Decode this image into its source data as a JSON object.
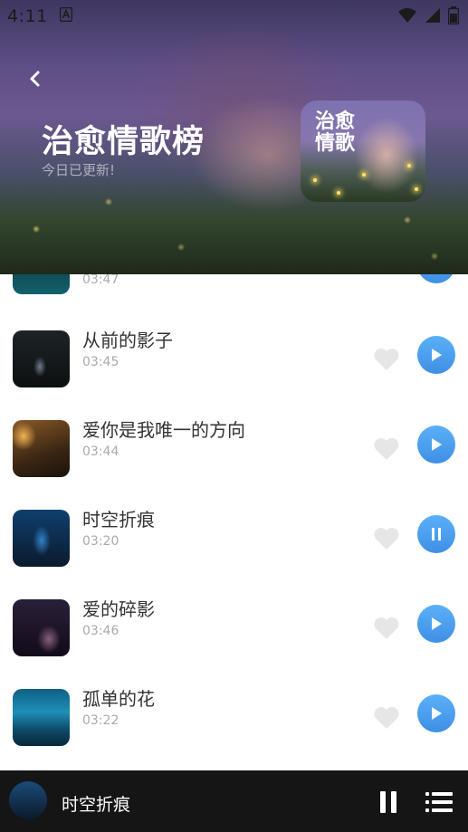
{
  "status_bar": {
    "time": "4:11",
    "icons": [
      "notification-a-icon",
      "wifi-icon",
      "signal-icon",
      "battery-icon"
    ]
  },
  "header": {
    "back_icon": "chevron-left-icon",
    "title": "治愈情歌榜",
    "subtitle": "今日已更新!",
    "cover_title": "治愈情歌"
  },
  "songs": [
    {
      "title": "",
      "duration": "03:47",
      "state": "play"
    },
    {
      "title": "从前的影子",
      "duration": "03:45",
      "state": "play"
    },
    {
      "title": "爱你是我唯一的方向",
      "duration": "03:44",
      "state": "play"
    },
    {
      "title": "时空折痕",
      "duration": "03:20",
      "state": "pause"
    },
    {
      "title": "爱的碎影",
      "duration": "03:46",
      "state": "play"
    },
    {
      "title": "孤单的花",
      "duration": "03:22",
      "state": "play"
    }
  ],
  "player": {
    "now_playing": "时空折痕",
    "pause_icon": "pause-icon",
    "queue_icon": "playlist-icon"
  },
  "colors": {
    "accent": "#4a9cee",
    "player_bg": "#151515",
    "heart": "#e6e6e6"
  }
}
